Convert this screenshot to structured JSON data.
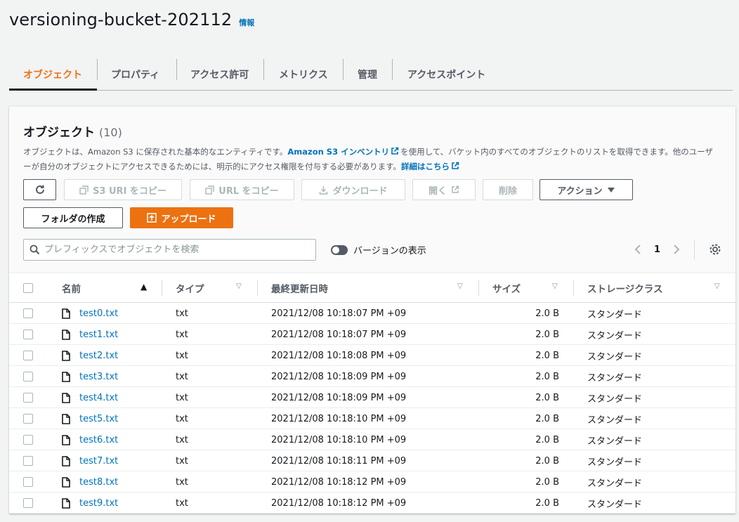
{
  "header": {
    "title": "versioning-bucket-202112",
    "info": "情報"
  },
  "tabs": [
    {
      "label": "オブジェクト",
      "active": true
    },
    {
      "label": "プロパティ"
    },
    {
      "label": "アクセス許可"
    },
    {
      "label": "メトリクス"
    },
    {
      "label": "管理"
    },
    {
      "label": "アクセスポイント"
    }
  ],
  "panel": {
    "title": "オブジェクト",
    "count": "(10)",
    "desc_part1": "オブジェクトは、Amazon S3 に保存された基本的なエンティティです。",
    "desc_link1": "Amazon S3 インベントリ",
    "desc_part2": "を使用して、バケット内のすべてのオブジェクトのリストを取得できます。他のユーザーが自分のオブジェクトにアクセスできるためには、明示的にアクセス権限を付与する必要があります。",
    "desc_link2": "詳細はこちら"
  },
  "toolbar": {
    "copy_uri": "S3 URI をコピー",
    "copy_url": "URL をコピー",
    "download": "ダウンロード",
    "open": "開く",
    "delete": "削除",
    "actions": "アクション",
    "create_folder": "フォルダの作成",
    "upload": "アップロード"
  },
  "search": {
    "placeholder": "プレフィックスでオブジェクトを検索"
  },
  "versions_toggle": {
    "label": "バージョンの表示",
    "on": false
  },
  "pagination": {
    "page": "1"
  },
  "table": {
    "columns": {
      "name": "名前",
      "type": "タイプ",
      "modified": "最終更新日時",
      "size": "サイズ",
      "storage": "ストレージクラス"
    },
    "rows": [
      {
        "name": "test0.txt",
        "type": "txt",
        "modified": "2021/12/08 10:18:07 PM +09",
        "size": "2.0 B",
        "storage": "スタンダード"
      },
      {
        "name": "test1.txt",
        "type": "txt",
        "modified": "2021/12/08 10:18:07 PM +09",
        "size": "2.0 B",
        "storage": "スタンダード"
      },
      {
        "name": "test2.txt",
        "type": "txt",
        "modified": "2021/12/08 10:18:08 PM +09",
        "size": "2.0 B",
        "storage": "スタンダード"
      },
      {
        "name": "test3.txt",
        "type": "txt",
        "modified": "2021/12/08 10:18:09 PM +09",
        "size": "2.0 B",
        "storage": "スタンダード"
      },
      {
        "name": "test4.txt",
        "type": "txt",
        "modified": "2021/12/08 10:18:09 PM +09",
        "size": "2.0 B",
        "storage": "スタンダード"
      },
      {
        "name": "test5.txt",
        "type": "txt",
        "modified": "2021/12/08 10:18:10 PM +09",
        "size": "2.0 B",
        "storage": "スタンダード"
      },
      {
        "name": "test6.txt",
        "type": "txt",
        "modified": "2021/12/08 10:18:10 PM +09",
        "size": "2.0 B",
        "storage": "スタンダード"
      },
      {
        "name": "test7.txt",
        "type": "txt",
        "modified": "2021/12/08 10:18:11 PM +09",
        "size": "2.0 B",
        "storage": "スタンダード"
      },
      {
        "name": "test8.txt",
        "type": "txt",
        "modified": "2021/12/08 10:18:12 PM +09",
        "size": "2.0 B",
        "storage": "スタンダード"
      },
      {
        "name": "test9.txt",
        "type": "txt",
        "modified": "2021/12/08 10:18:12 PM +09",
        "size": "2.0 B",
        "storage": "スタンダード"
      }
    ]
  },
  "colors": {
    "accent": "#ec7211",
    "link": "#0073bb",
    "text": "#16191f",
    "muted": "#545b64"
  }
}
